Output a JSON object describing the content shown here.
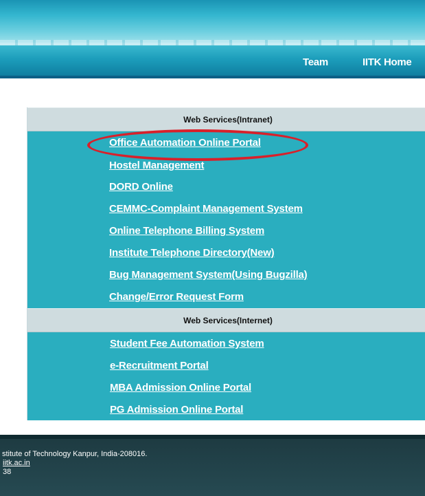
{
  "header": {
    "nav": [
      {
        "label": "Team"
      },
      {
        "label": "IITK Home"
      }
    ]
  },
  "intranet": {
    "title": "Web Services(Intranet)",
    "links": [
      "Office Automation Online Portal",
      "Hostel Management",
      "DORD Online",
      "CEMMC-Complaint Management System",
      "Online Telephone Billing System",
      "Institute Telephone Directory(New)",
      "Bug Management System(Using Bugzilla)",
      "Change/Error Request Form"
    ]
  },
  "internet": {
    "title": "Web Services(Internet)",
    "links": [
      "Student Fee Automation System",
      "e-Recruitment Portal",
      "MBA Admission Online Portal",
      "PG Admission Online Portal"
    ]
  },
  "footer": {
    "address": "stitute of Technology Kanpur, India-208016.",
    "email": "iitk.ac.in",
    "phone": "38"
  },
  "colors": {
    "panel": "#2aaebf",
    "section_header": "#cfdcdf",
    "highlight": "#d9202a",
    "footer": "#264a52"
  }
}
